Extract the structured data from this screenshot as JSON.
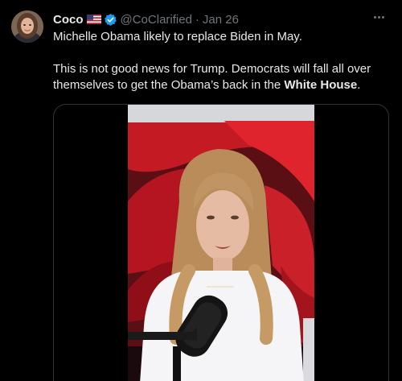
{
  "tweet": {
    "author_name": "Coco",
    "author_handle": "@CoClarified",
    "separator": "·",
    "date": "Jan 26",
    "line1": "Michelle Obama likely to replace Biden in May.",
    "line2_prefix": "This is not good news for Trump. Democrats will fall all over themselves to get the Obama’s back in the ",
    "line2_bold": "White House",
    "line2_suffix": "."
  },
  "icons": {
    "flag": "us-flag-icon",
    "verified": "verified-badge-icon",
    "more": "more-options-icon"
  },
  "colors": {
    "background": "#000000",
    "text": "#e7e9ea",
    "secondary": "#71767b",
    "verified_blue": "#1d9bf0",
    "border": "#2f3336"
  }
}
